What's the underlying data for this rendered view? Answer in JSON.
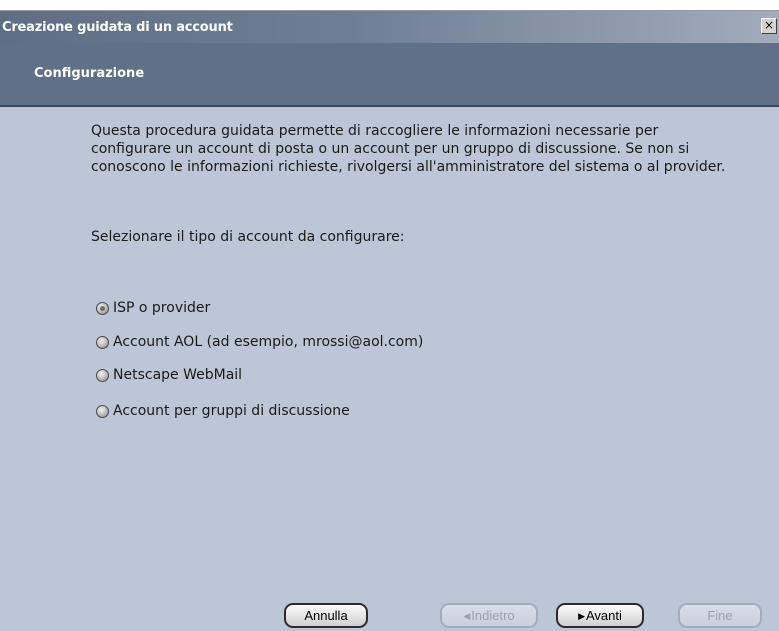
{
  "window": {
    "title": "Creazione guidata di un account",
    "close_glyph": "×"
  },
  "header": {
    "title": "Configurazione"
  },
  "main": {
    "intro": "Questa procedura guidata permette di raccogliere le informazioni necessarie per configurare un account di posta o un account per un gruppo di discussione. Se non si conoscono le informazioni richieste, rivolgersi all'amministratore del sistema o al provider.",
    "prompt": "Selezionare il tipo di account da configurare:",
    "options": [
      {
        "label": "ISP o provider",
        "checked": true
      },
      {
        "label": "Account AOL (ad esempio, mrossi@aol.com)",
        "checked": false
      },
      {
        "label": "Netscape WebMail",
        "checked": false
      },
      {
        "label": "Account per gruppi di discussione",
        "checked": false
      }
    ]
  },
  "buttons": {
    "cancel": "Annulla",
    "back": "Indietro",
    "next": "Avanti",
    "finish": "Fine",
    "back_arrow": "◀",
    "next_arrow": "▶"
  },
  "colors": {
    "header_bg": "#5f7089",
    "content_bg": "#bdc6d6",
    "title_text": "#ffffff"
  }
}
